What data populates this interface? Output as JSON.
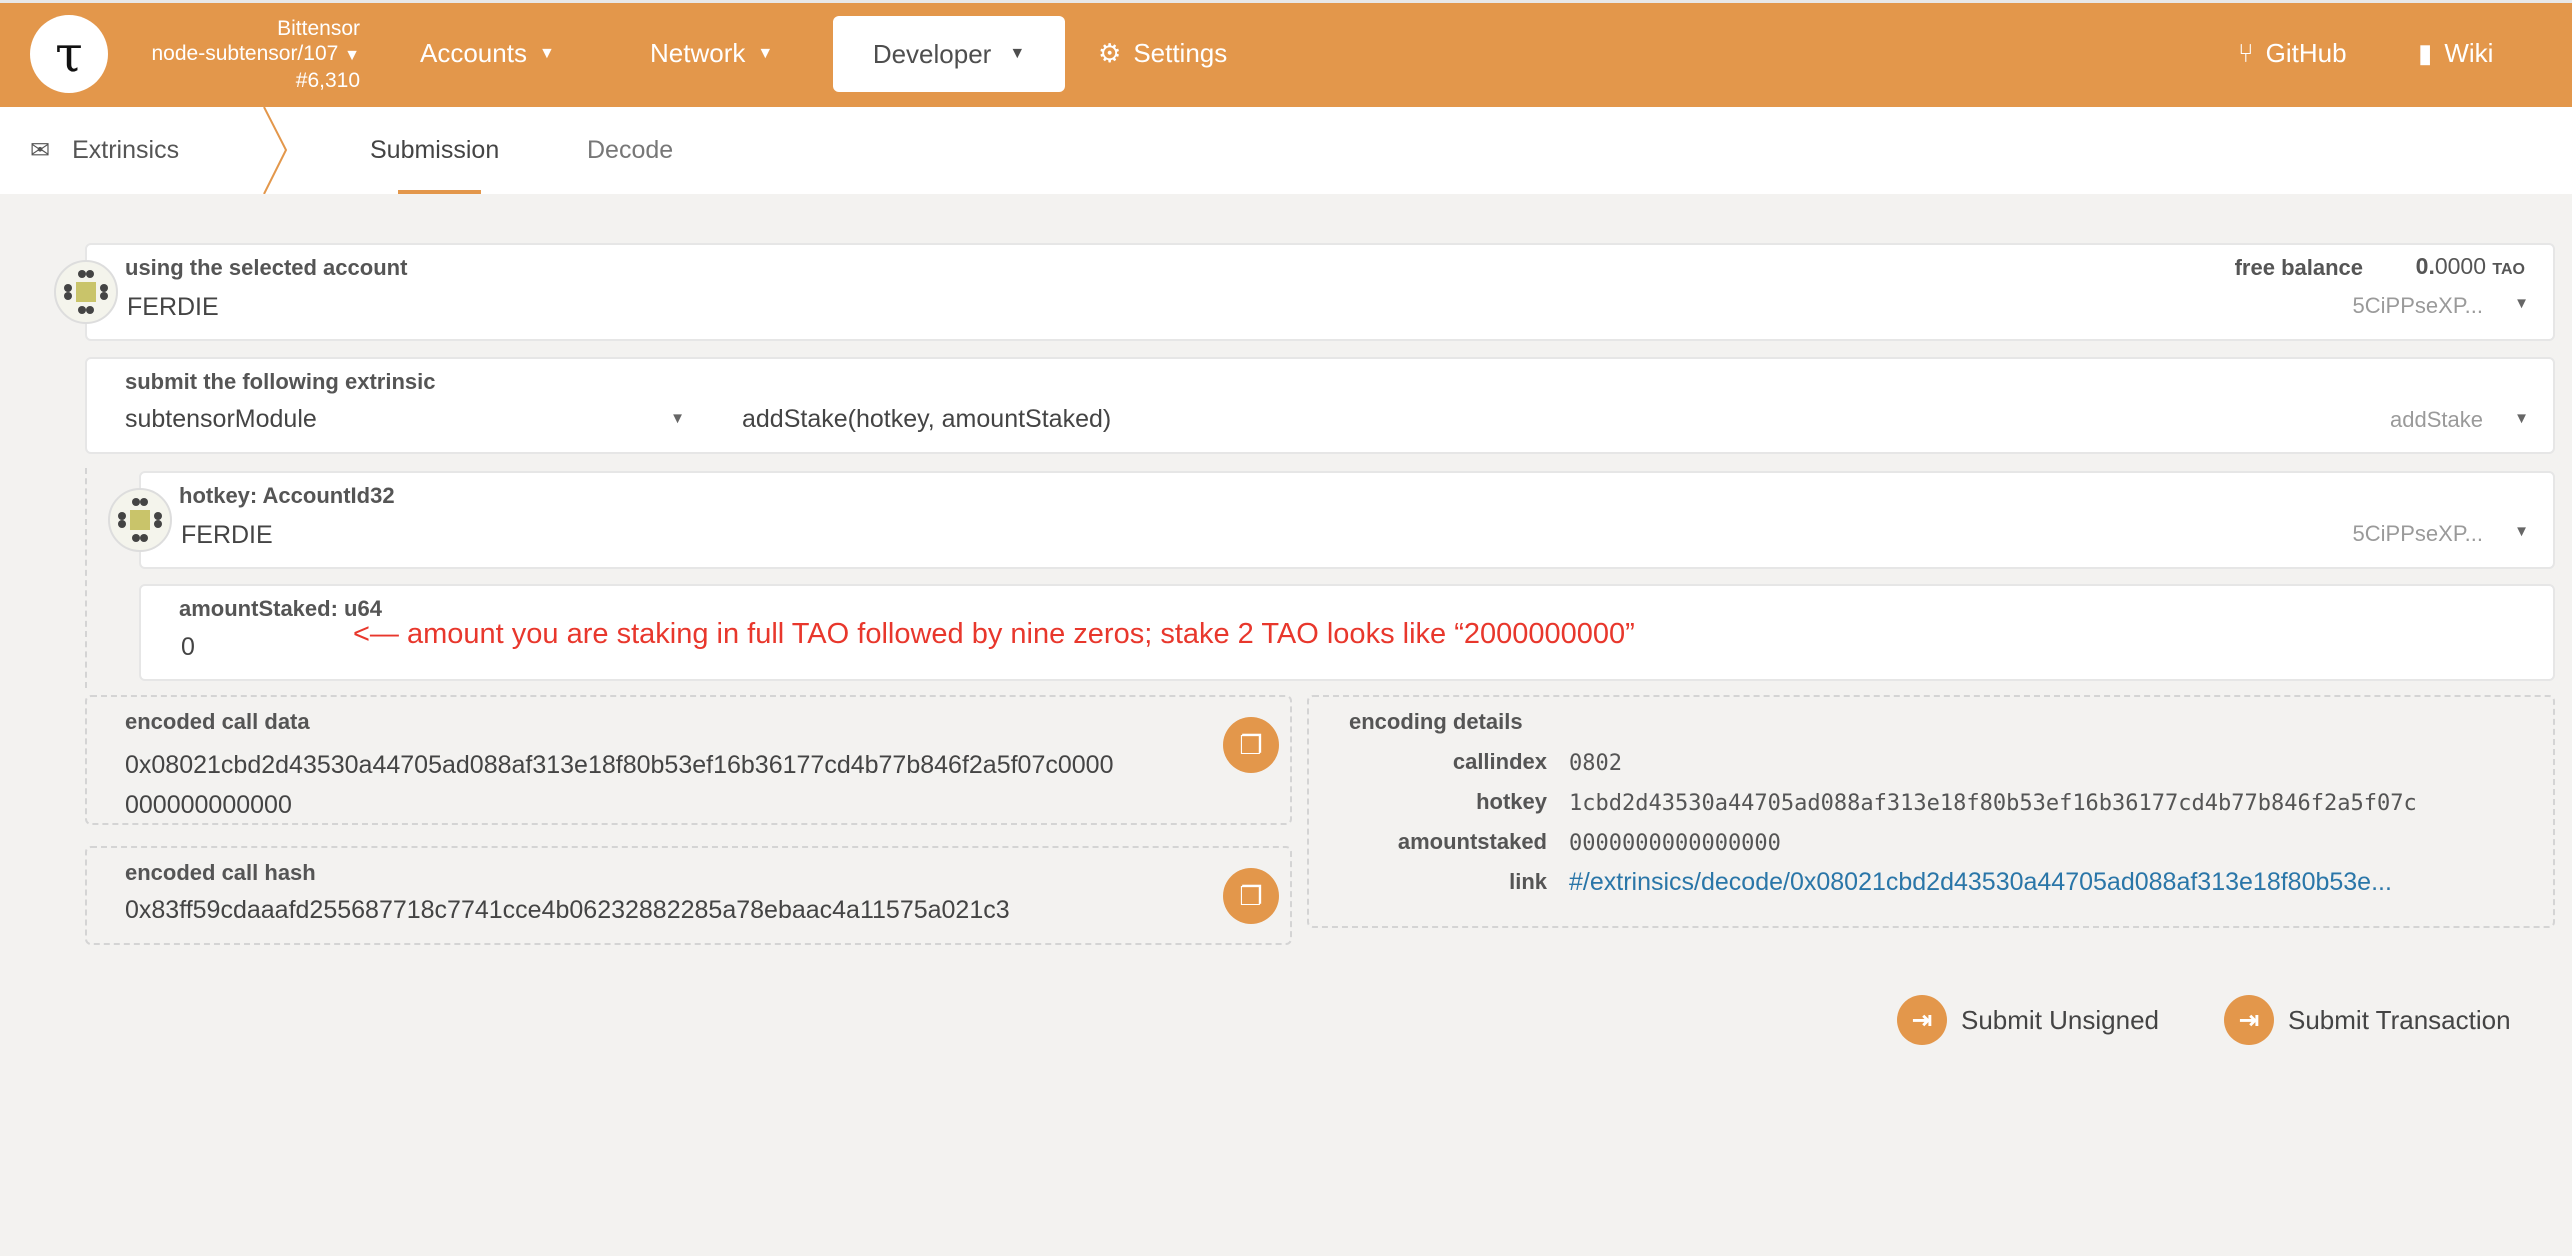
{
  "header": {
    "chain_name": "Bittensor",
    "node": "node-subtensor/107",
    "block": "#6,310",
    "nav": [
      {
        "label": "Accounts",
        "icon": "caret-down-icon"
      },
      {
        "label": "Network",
        "icon": "caret-down-icon"
      },
      {
        "label": "Developer",
        "icon": "caret-down-icon",
        "active": true
      },
      {
        "label": "Settings",
        "icon": "gears-icon"
      }
    ],
    "github": "GitHub",
    "wiki": "Wiki",
    "accent_color": "#e3974b"
  },
  "subnav": {
    "section": "Extrinsics",
    "tabs": [
      "Submission",
      "Decode"
    ],
    "active_tab": "Submission"
  },
  "account": {
    "label": "using the selected account",
    "name": "FERDIE",
    "balance_label": "free balance",
    "balance_int": "0.",
    "balance_dec": "0000",
    "unit": "TAO",
    "address": "5CiPPseXP..."
  },
  "extrinsic": {
    "label": "submit the following extrinsic",
    "module": "subtensorModule",
    "call": "addStake(hotkey, amountStaked)",
    "method": "addStake"
  },
  "params": {
    "hotkey_label": "hotkey: AccountId32",
    "hotkey_name": "FERDIE",
    "hotkey_address": "5CiPPseXP...",
    "amount_label": "amountStaked: u64",
    "amount_value": "0",
    "annotation": "<— amount you are staking in full TAO followed by nine zeros; stake 2 TAO looks like “2000000000”"
  },
  "encoded": {
    "data_label": "encoded call data",
    "data_line1": "0x08021cbd2d43530a44705ad088af313e18f80b53ef16b36177cd4b77b846f2a5f07c0000",
    "data_line2": "000000000000",
    "hash_label": "encoded call hash",
    "hash_value": "0x83ff59cdaaafd255687718c7741cce4b06232882285a78ebaac4a11575a021c3"
  },
  "details": {
    "title": "encoding details",
    "rows": [
      {
        "key": "callindex",
        "value": "0802"
      },
      {
        "key": "hotkey",
        "value": "1cbd2d43530a44705ad088af313e18f80b53ef16b36177cd4b77b846f2a5f07c"
      },
      {
        "key": "amountstaked",
        "value": "0000000000000000"
      },
      {
        "key": "link",
        "value": "#/extrinsics/decode/0x08021cbd2d43530a44705ad088af313e18f80b53e..."
      }
    ]
  },
  "actions": {
    "unsigned": "Submit Unsigned",
    "transaction": "Submit Transaction"
  }
}
